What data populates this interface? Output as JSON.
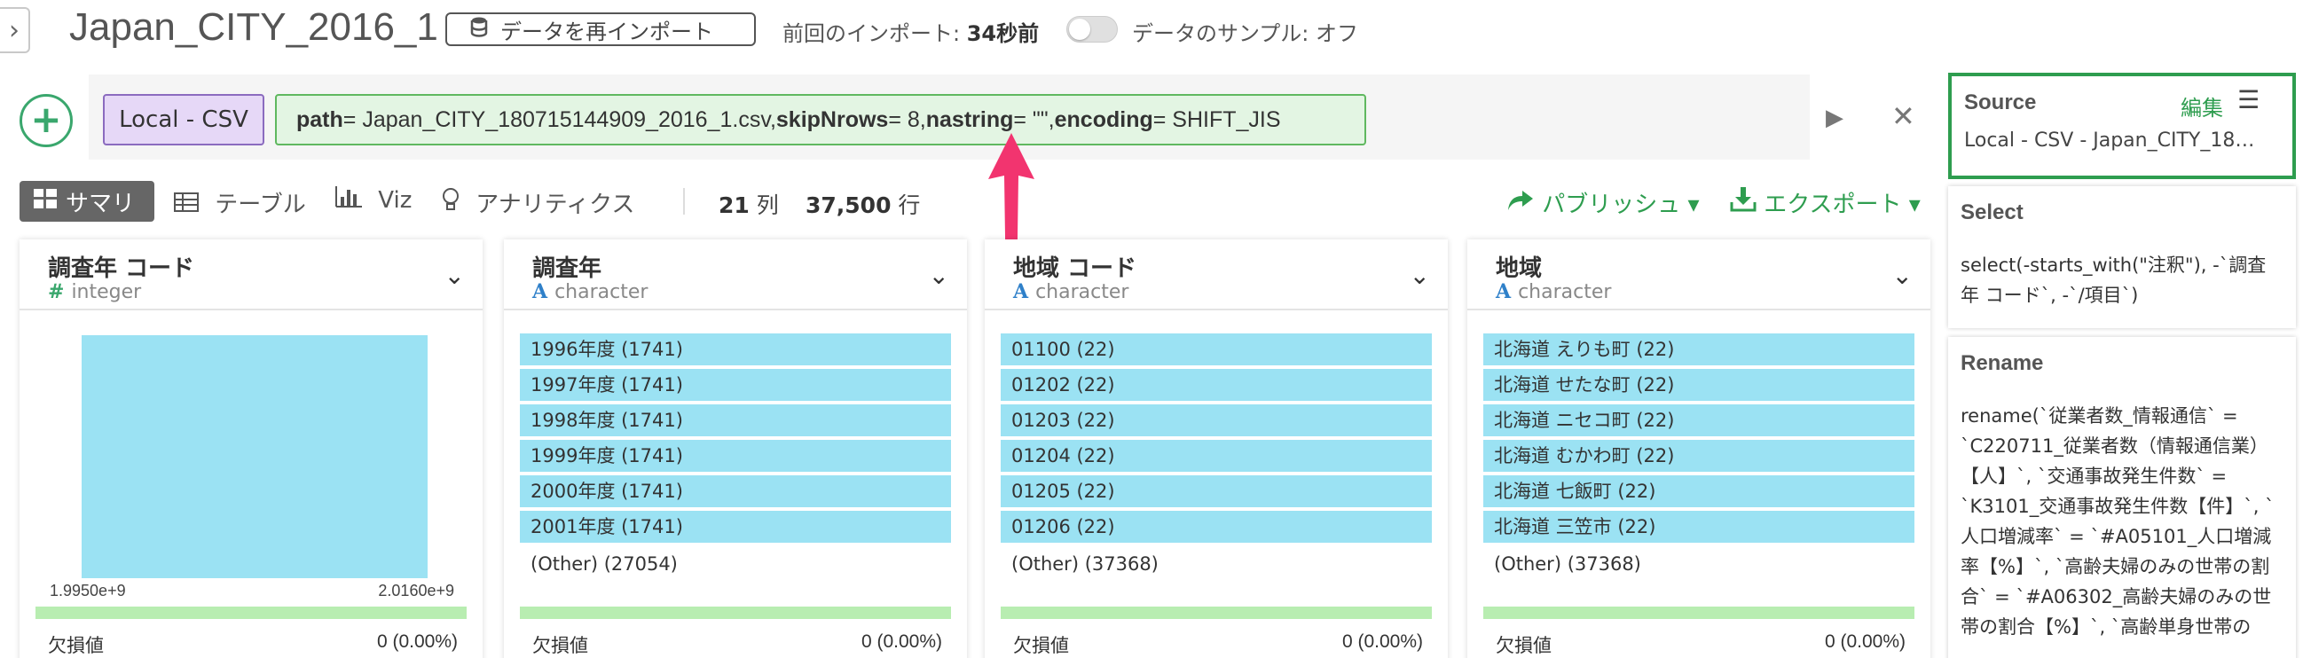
{
  "header": {
    "title": "Japan_CITY_2016_1",
    "reimport_label": "データを再インポート",
    "last_import_label": "前回のインポート: ",
    "last_import_value": "34秒前",
    "sample_label": "データのサンプル: オフ"
  },
  "command": {
    "source_chip": "Local - CSV",
    "params": [
      {
        "key": "path",
        "value": " = Japan_CITY_180715144909_2016_1.csv, "
      },
      {
        "key": "skipNrows",
        "value": " = 8, "
      },
      {
        "key": "nastring",
        "value": " = \"\", "
      },
      {
        "key": "encoding",
        "value": " = SHIFT_JIS"
      }
    ]
  },
  "tabs": {
    "summary": "サマリ",
    "table": "テーブル",
    "viz": "Viz",
    "analytics": "アナリティクス"
  },
  "stats": {
    "cols_value": "21",
    "cols_unit": " 列",
    "rows_value": "37,500",
    "rows_unit": " 行"
  },
  "actions": {
    "publish": "パブリッシュ",
    "export": "エクスポート"
  },
  "columns": [
    {
      "name": "調査年 コード",
      "type": "integer",
      "histogram": {
        "min": "1.9950e+9",
        "max": "2.0160e+9"
      },
      "missing_label": "欠損値",
      "missing_value": "0 (0.00%)"
    },
    {
      "name": "調査年",
      "type": "character",
      "values": [
        "1996年度 (1741)",
        "1997年度 (1741)",
        "1998年度 (1741)",
        "1999年度 (1741)",
        "2000年度 (1741)",
        "2001年度 (1741)"
      ],
      "other": "(Other) (27054)",
      "missing_label": "欠損値",
      "missing_value": "0 (0.00%)"
    },
    {
      "name": "地域 コード",
      "type": "character",
      "values": [
        "01100 (22)",
        "01202 (22)",
        "01203 (22)",
        "01204 (22)",
        "01205 (22)",
        "01206 (22)"
      ],
      "other": "(Other) (37368)",
      "missing_label": "欠損値",
      "missing_value": "0 (0.00%)"
    },
    {
      "name": "地域",
      "type": "character",
      "values": [
        "北海道 えりも町 (22)",
        "北海道 せたな町 (22)",
        "北海道 ニセコ町 (22)",
        "北海道 むかわ町 (22)",
        "北海道 七飯町 (22)",
        "北海道 三笠市 (22)"
      ],
      "other": "(Other) (37368)",
      "missing_label": "欠損値",
      "missing_value": "0 (0.00%)"
    }
  ],
  "steps": {
    "source": {
      "title": "Source",
      "edit": "編集",
      "desc": "Local - CSV - Japan_CITY_18…"
    },
    "select": {
      "title": "Select",
      "body": "select(-starts_with(\"注釈\"), -`調査年 コード`, -`/項目`)"
    },
    "rename": {
      "title": "Rename",
      "body": "rename(`従業者数_情報通信` = `C220711_従業者数（情報通信業）【人】`, `交通事故発生件数` = `K3101_交通事故発生件数【件】`, `人口増減率` = `#A05101_人口増減率【%】`, `高齢夫婦のみの世帯の割合` = `#A06302_高齢夫婦のみの世帯の割合【%】`, `高齢単身世帯の"
    }
  },
  "colors": {
    "accent_green": "#2e9d4f",
    "bar_blue": "#9be2f3",
    "missing_green": "#b8edb1",
    "arrow_pink": "#f2346f"
  }
}
